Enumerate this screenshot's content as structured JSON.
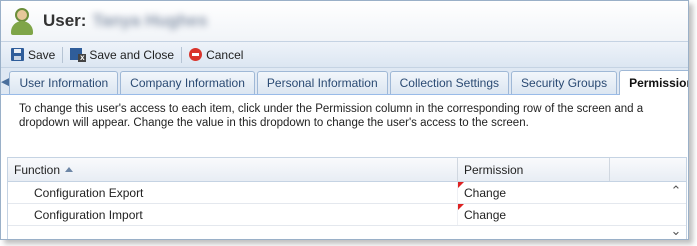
{
  "header": {
    "title_label": "User:",
    "user_name": "Tanya Hughes"
  },
  "toolbar": {
    "save_label": "Save",
    "save_close_label": "Save and Close",
    "cancel_label": "Cancel"
  },
  "tabs": [
    {
      "label": "User Information",
      "active": false
    },
    {
      "label": "Company Information",
      "active": false
    },
    {
      "label": "Personal Information",
      "active": false
    },
    {
      "label": "Collection Settings",
      "active": false
    },
    {
      "label": "Security Groups",
      "active": false
    },
    {
      "label": "Permissions",
      "active": true
    }
  ],
  "description": "To change this user's access to each item, click under the Permission column in the corresponding row of the screen and a dropdown will appear. Change the value in this dropdown to change the user's access to the screen.",
  "grid": {
    "columns": {
      "function": "Function",
      "permission": "Permission"
    },
    "rows": [
      {
        "function": "Configuration Export",
        "permission": "Change"
      },
      {
        "function": "Configuration Import",
        "permission": "Change"
      }
    ]
  },
  "colors": {
    "accent": "#99bbe8",
    "tab_text": "#2a4a73",
    "cancel_icon": "#d9342b",
    "dirty_marker": "#dd2222"
  },
  "icons": [
    "user-avatar-icon",
    "save-icon",
    "save-close-icon",
    "cancel-icon",
    "arrow-left-icon",
    "arrow-right-icon",
    "sort-asc-icon",
    "chevron-up-icon",
    "chevron-down-icon"
  ]
}
